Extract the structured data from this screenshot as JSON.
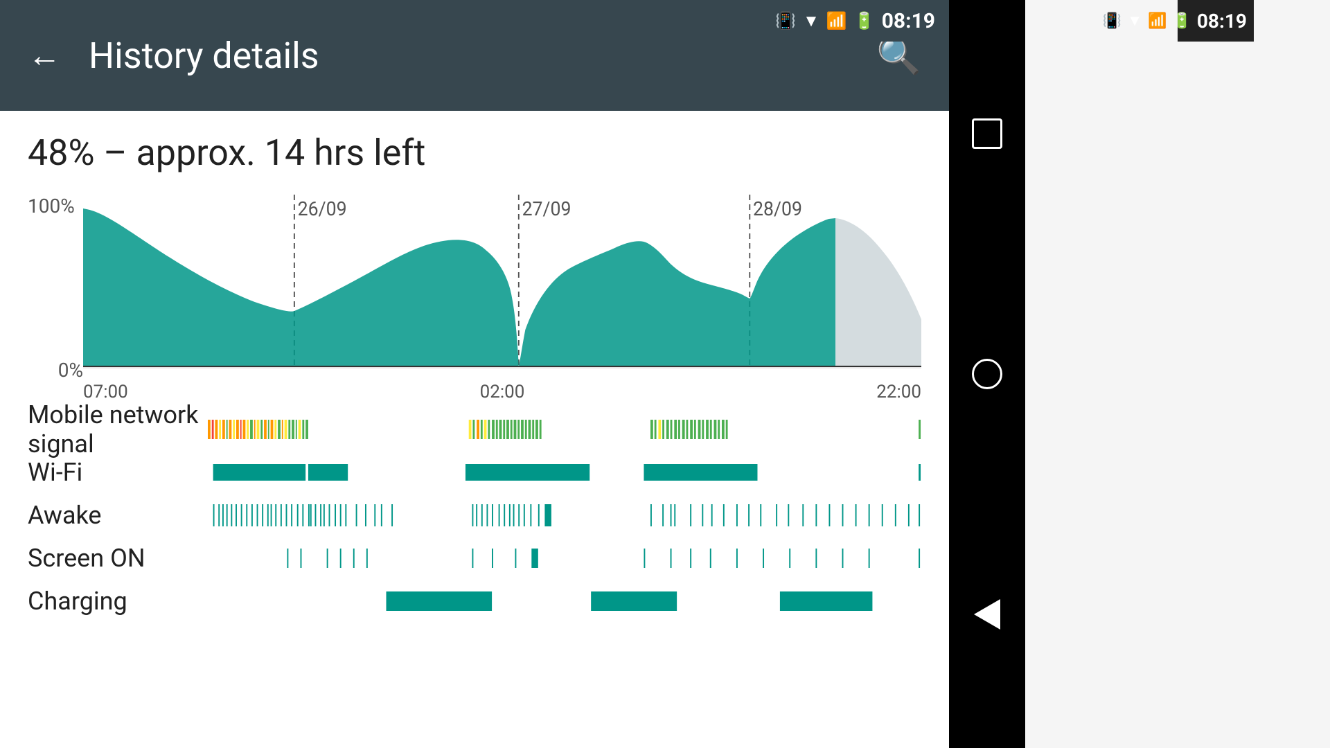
{
  "status_bar": {
    "time": "08:19",
    "icons": [
      "vibrate",
      "wifi",
      "signal",
      "battery"
    ]
  },
  "header": {
    "back_label": "←",
    "title": "History details",
    "search_label": "🔍"
  },
  "summary": {
    "text": "48% – approx. 14 hrs left"
  },
  "chart": {
    "y_labels": [
      "100%",
      "0%"
    ],
    "x_labels": [
      "07:00",
      "02:00",
      "22:00"
    ],
    "date_markers": [
      "26/09",
      "27/09",
      "28/09"
    ]
  },
  "activities": [
    {
      "label": "Mobile network signal"
    },
    {
      "label": "Wi-Fi"
    },
    {
      "label": "Awake"
    },
    {
      "label": "Screen ON"
    },
    {
      "label": "Charging"
    }
  ],
  "nav": {
    "square_label": "recent",
    "circle_label": "home",
    "triangle_label": "back"
  }
}
